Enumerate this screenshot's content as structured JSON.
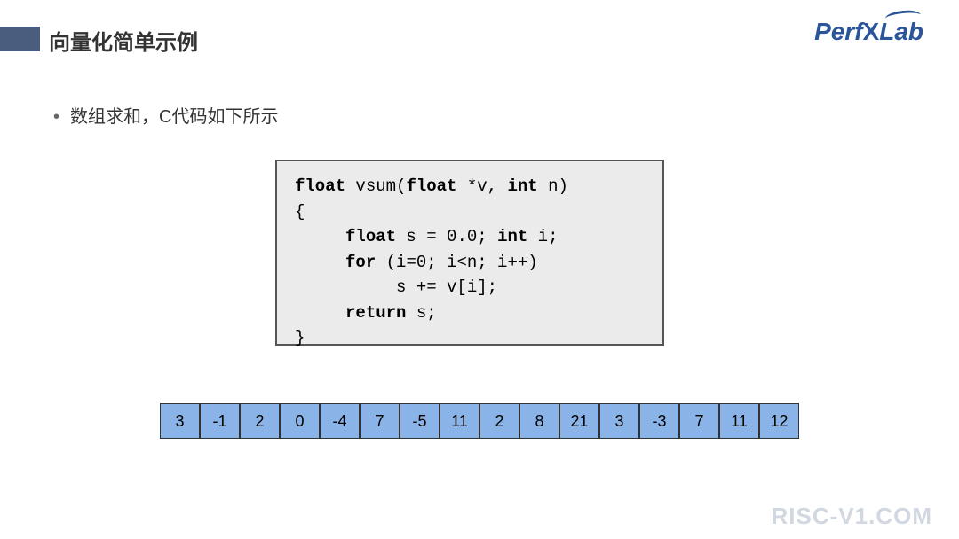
{
  "header": {
    "title": "向量化简单示例",
    "logo_prefix": "Perf",
    "logo_x": "X",
    "logo_suffix": "Lab"
  },
  "body": {
    "bullet": "•",
    "description": "数组求和，C代码如下所示"
  },
  "code": {
    "line1_kw1": "float",
    "line1_mid": " vsum(",
    "line1_kw2": "float",
    "line1_mid2": " *v, ",
    "line1_kw3": "int",
    "line1_end": " n)",
    "line2": "{",
    "line3_pre": "     ",
    "line3_kw1": "float",
    "line3_mid": " s = 0.0; ",
    "line3_kw2": "int",
    "line3_end": " i;",
    "line4_pre": "     ",
    "line4_kw": "for",
    "line4_end": " (i=0; i<n; i++)",
    "line5": "          s += v[i];",
    "line6_pre": "     ",
    "line6_kw": "return",
    "line6_end": " s;",
    "line7": "}"
  },
  "array": {
    "values": [
      "3",
      "-1",
      "2",
      "0",
      "-4",
      "7",
      "-5",
      "11",
      "2",
      "8",
      "21",
      "3",
      "-3",
      "7",
      "11",
      "12"
    ]
  },
  "footer": {
    "watermark": "RISC-V1.COM"
  }
}
